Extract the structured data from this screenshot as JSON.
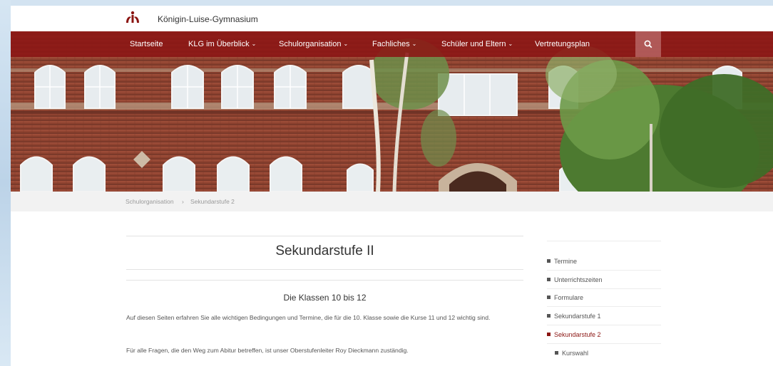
{
  "site": {
    "name": "Königin-Luise-Gymnasium",
    "brand_color": "#8b1512"
  },
  "nav": {
    "items": [
      {
        "label": "Startseite",
        "has_dropdown": false
      },
      {
        "label": "KLG im Überblick",
        "has_dropdown": true
      },
      {
        "label": "Schulorganisation",
        "has_dropdown": true
      },
      {
        "label": "Fachliches",
        "has_dropdown": true
      },
      {
        "label": "Schüler und Eltern",
        "has_dropdown": true
      },
      {
        "label": "Vertretungsplan",
        "has_dropdown": false
      }
    ],
    "search_icon": "search-icon"
  },
  "breadcrumb": {
    "items": [
      "Schulorganisation",
      "Sekundarstufe 2"
    ],
    "separator": "›"
  },
  "main": {
    "title": "Sekundarstufe II",
    "section_title": "Die Klassen 10 bis 12",
    "paragraphs": [
      "Auf diesen Seiten erfahren Sie alle wichtigen Bedingungen und Termine, die für die 10. Klasse sowie die Kurse 11 und 12 wichtig sind.",
      "Für alle Fragen, die den Weg zum Abitur betreffen, ist unser Oberstufenleiter Roy Dieckmann zuständig."
    ]
  },
  "sidebar": {
    "items": [
      {
        "label": "Termine",
        "active": false
      },
      {
        "label": "Unterrichtszeiten",
        "active": false
      },
      {
        "label": "Formulare",
        "active": false
      },
      {
        "label": "Sekundarstufe 1",
        "active": false
      },
      {
        "label": "Sekundarstufe 2",
        "active": true
      },
      {
        "label": "Kurswahl",
        "active": false,
        "sub": true
      }
    ]
  }
}
